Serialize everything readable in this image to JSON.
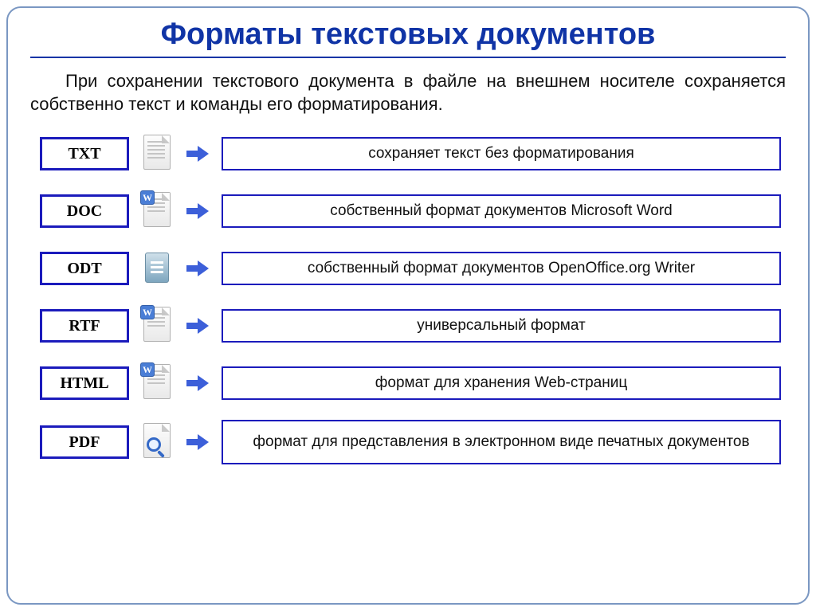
{
  "title": "Форматы текстовых документов",
  "intro": "При сохранении текстового документа в файле на внешнем носителе сохраняется собственно текст и команды его форматирования.",
  "formats": [
    {
      "code": "TXT",
      "icon": "txt",
      "desc": "сохраняет текст без форматирования"
    },
    {
      "code": "DOC",
      "icon": "word",
      "desc": "собственный формат документов Microsoft Word"
    },
    {
      "code": "ODT",
      "icon": "oo",
      "desc": "собственный формат документов OpenOffice.org Writer"
    },
    {
      "code": "RTF",
      "icon": "word",
      "desc": "универсальный формат"
    },
    {
      "code": "HTML",
      "icon": "word",
      "desc": "формат для хранения Web-страниц"
    },
    {
      "code": "PDF",
      "icon": "pdf",
      "desc": "формат для представления в электронном виде печатных документов"
    }
  ]
}
